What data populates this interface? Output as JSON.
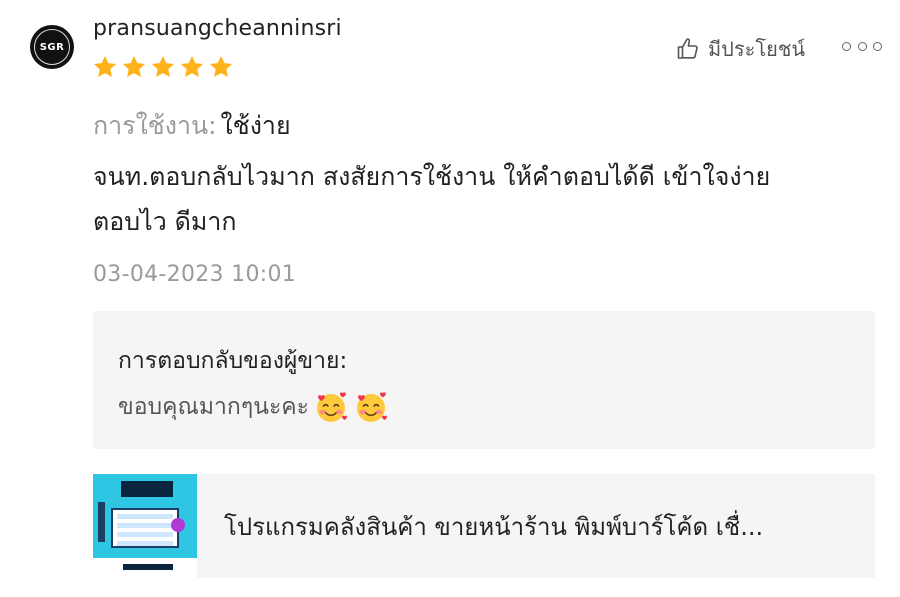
{
  "review": {
    "username": "pransuangcheanninsri",
    "avatar_text": "SGR",
    "rating": 5,
    "helpful_label": "มีประโยชน์",
    "usage_label": "การใช้งาน:",
    "usage_value": "ใช้ง่าย",
    "comment_line1": "จนท.ตอบกลับไวมาก สงสัยการใช้งาน ให้คำตอบได้ดี เข้าใจง่าย",
    "comment_line2": "ตอบไว ดีมาก",
    "timestamp": "03-04-2023 10:01"
  },
  "seller_reply": {
    "title": "การตอบกลับของผู้ขาย:",
    "text": "ขอบคุณมากๆนะคะ"
  },
  "product": {
    "name": "โปรแกรมคลังสินค้า ขายหน้าร้าน พิมพ์บาร์โค้ด เชื่..."
  },
  "colors": {
    "star": "#FFB31A",
    "muted_text": "#9a9a9a",
    "panel_bg": "#f5f5f5"
  },
  "icons": [
    "thumbs-up-icon",
    "more-options-icon",
    "star-icon",
    "smiling-face-with-hearts-icon"
  ]
}
